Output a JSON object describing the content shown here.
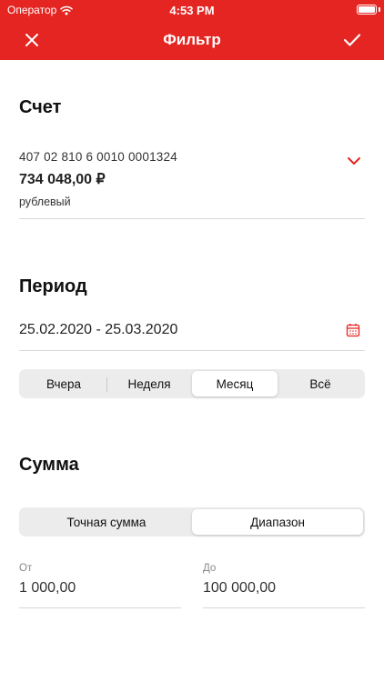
{
  "status_bar": {
    "carrier": "Оператор",
    "time": "4:53 PM"
  },
  "nav": {
    "title": "Фильтр",
    "close_icon": "close-icon",
    "done_icon": "checkmark-icon"
  },
  "colors": {
    "brand_red": "#e52521",
    "segment_bg": "#ececec",
    "divider": "#d8d8d8"
  },
  "account": {
    "section_title": "Счет",
    "number": "407 02 810 6 0010 0001324",
    "balance": "734 048,00 ₽",
    "currency": "рублевый",
    "chevron_icon": "chevron-down-icon"
  },
  "period": {
    "section_title": "Период",
    "value": "25.02.2020 - 25.03.2020",
    "calendar_icon": "calendar-icon",
    "segments": [
      {
        "label": "Вчера",
        "selected": false
      },
      {
        "label": "Неделя",
        "selected": false
      },
      {
        "label": "Месяц",
        "selected": true
      },
      {
        "label": "Всё",
        "selected": false
      }
    ]
  },
  "amount": {
    "section_title": "Сумма",
    "segments": [
      {
        "label": "Точная сумма",
        "selected": false
      },
      {
        "label": "Диапазон",
        "selected": true
      }
    ],
    "from": {
      "label": "От",
      "value": "1 000,00"
    },
    "to": {
      "label": "До",
      "value": "100 000,00"
    }
  }
}
